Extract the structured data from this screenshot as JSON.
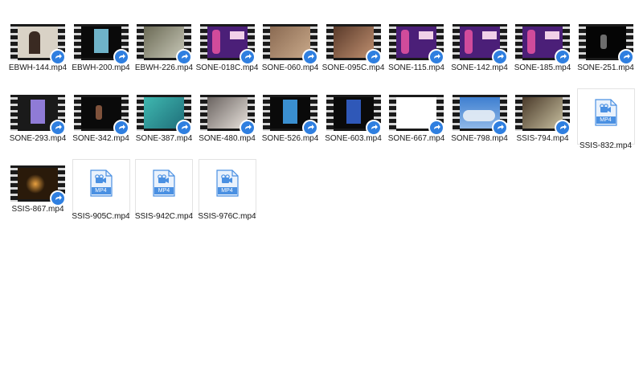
{
  "files": [
    {
      "name": "EBWH-144.mp4",
      "kind": "video",
      "thumb": {
        "bg": "#d9d2c6",
        "accent": "#3a2a22",
        "style": "portrait"
      }
    },
    {
      "name": "EBWH-200.mp4",
      "kind": "video",
      "thumb": {
        "bg": "#0a0a0a",
        "accent": "#6fb3c9",
        "style": "card"
      }
    },
    {
      "name": "EBWH-226.mp4",
      "kind": "video",
      "thumb": {
        "bg": "#6b6a55",
        "accent": "#c8c8b8",
        "style": "scene"
      }
    },
    {
      "name": "SONE-018C.mp4",
      "kind": "video",
      "thumb": {
        "bg": "#4b1f78",
        "accent": "#d04b9b",
        "style": "stage"
      }
    },
    {
      "name": "SONE-060.mp4",
      "kind": "video",
      "thumb": {
        "bg": "#8a6a52",
        "accent": "#c9a98a",
        "style": "scene"
      }
    },
    {
      "name": "SONE-095C.mp4",
      "kind": "video",
      "thumb": {
        "bg": "#5a3a2a",
        "accent": "#c09070",
        "style": "scene"
      }
    },
    {
      "name": "SONE-115.mp4",
      "kind": "video",
      "thumb": {
        "bg": "#4b1f78",
        "accent": "#d04b9b",
        "style": "stage"
      }
    },
    {
      "name": "SONE-142.mp4",
      "kind": "video",
      "thumb": {
        "bg": "#4b1f78",
        "accent": "#d04b9b",
        "style": "stage"
      }
    },
    {
      "name": "SONE-185.mp4",
      "kind": "video",
      "thumb": {
        "bg": "#4b1f78",
        "accent": "#d04b9b",
        "style": "stage"
      }
    },
    {
      "name": "SONE-251.mp4",
      "kind": "video",
      "thumb": {
        "bg": "#050505",
        "accent": "#9a9a9a",
        "style": "dark"
      }
    },
    {
      "name": "SONE-293.mp4",
      "kind": "video",
      "thumb": {
        "bg": "#1a1a1a",
        "accent": "#8f7bd6",
        "style": "card"
      }
    },
    {
      "name": "SONE-342.mp4",
      "kind": "video",
      "thumb": {
        "bg": "#0a0a0a",
        "accent": "#b07050",
        "style": "dark"
      }
    },
    {
      "name": "SONE-387.mp4",
      "kind": "video",
      "thumb": {
        "bg": "#3fb8b0",
        "accent": "#1f6f7a",
        "style": "scene"
      }
    },
    {
      "name": "SONE-480.mp4",
      "kind": "video",
      "thumb": {
        "bg": "#6a6360",
        "accent": "#e8e2dc",
        "style": "scene"
      }
    },
    {
      "name": "SONE-526.mp4",
      "kind": "video",
      "thumb": {
        "bg": "#0a0a0a",
        "accent": "#3a8fd0",
        "style": "card"
      }
    },
    {
      "name": "SONE-603.mp4",
      "kind": "video",
      "thumb": {
        "bg": "#0a0a0a",
        "accent": "#2f58b8",
        "style": "card"
      }
    },
    {
      "name": "SONE-667.mp4",
      "kind": "video",
      "thumb": {
        "bg": "#ffffff",
        "accent": "#ffffff",
        "style": "blank"
      }
    },
    {
      "name": "SONE-798.mp4",
      "kind": "video",
      "thumb": {
        "bg": "#4a8fd8",
        "accent": "#e8eef5",
        "style": "sky"
      }
    },
    {
      "name": "SSIS-794.mp4",
      "kind": "video",
      "thumb": {
        "bg": "#4a3a2a",
        "accent": "#c8c0a0",
        "style": "scene"
      }
    },
    {
      "name": "SSIS-832.mp4",
      "kind": "doc"
    },
    {
      "name": "SSIS-867.mp4",
      "kind": "video",
      "thumb": {
        "bg": "#2a1a0a",
        "accent": "#e8a040",
        "style": "glow"
      }
    },
    {
      "name": "SSIS-905C.mp4",
      "kind": "doc"
    },
    {
      "name": "SSIS-942C.mp4",
      "kind": "doc"
    },
    {
      "name": "SSIS-976C.mp4",
      "kind": "doc"
    }
  ],
  "doc_icon_label": "MP4",
  "colors": {
    "badge": "#2f7fe0",
    "doc_icon": "#4a90e2",
    "label_text": "#1a1a1a"
  },
  "icons": {
    "video_badge": "share-arrow-icon",
    "doc": "video-file-icon"
  }
}
